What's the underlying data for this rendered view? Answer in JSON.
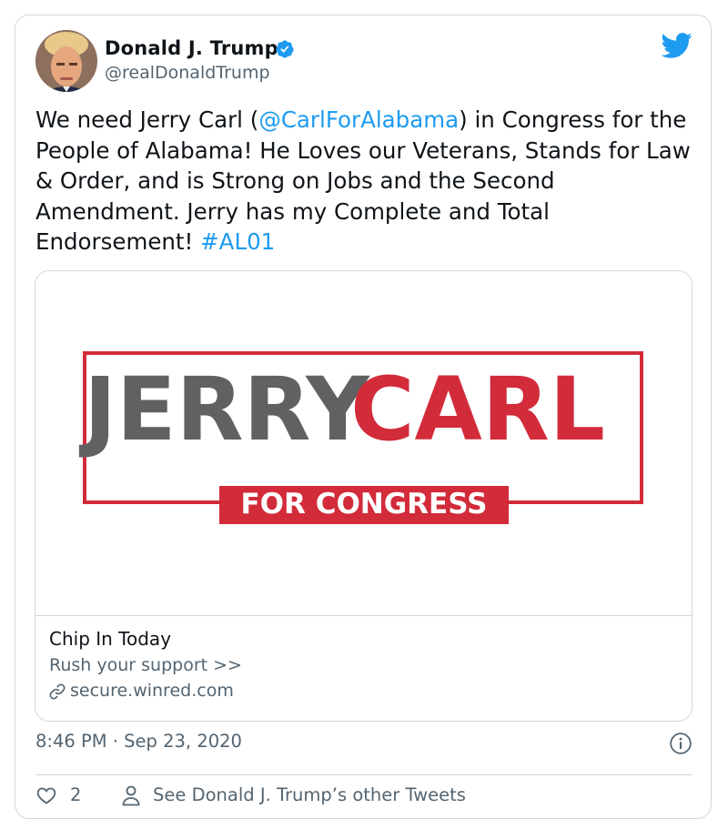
{
  "author": {
    "name": "Donald J. Trump",
    "handle": "@realDonaldTrump"
  },
  "tweet": {
    "text_parts": [
      {
        "text": "We need Jerry Carl (",
        "type": "plain"
      },
      {
        "text": "@CarlForAlabama",
        "type": "mention"
      },
      {
        "text": ") in Congress for the People of Alabama! He Loves our Veterans, Stands for Law & Order, and is Strong on Jobs and the Second Amendment. Jerry has my Complete and Total Endorsement! ",
        "type": "plain"
      },
      {
        "text": "#AL01",
        "type": "hashtag"
      }
    ]
  },
  "card": {
    "logo_text_left": "JERRY",
    "logo_text_right": "CARL",
    "logo_subtitle": "FOR CONGRESS",
    "title": "Chip In Today",
    "description": "Rush your support >>",
    "domain": "secure.winred.com"
  },
  "meta": {
    "timestamp": "8:46 PM · Sep 23, 2020"
  },
  "actions": {
    "like_count": "2",
    "other_tweets_label": "See Donald J. Trump’s other Tweets"
  },
  "colors": {
    "link": "#1d9bf0",
    "muted": "#536471",
    "logo_red": "#d22b3a",
    "logo_gray": "#5f6163"
  },
  "icons": [
    "verified-badge-icon",
    "twitter-bird-icon",
    "link-icon",
    "info-icon",
    "heart-icon",
    "person-icon"
  ]
}
